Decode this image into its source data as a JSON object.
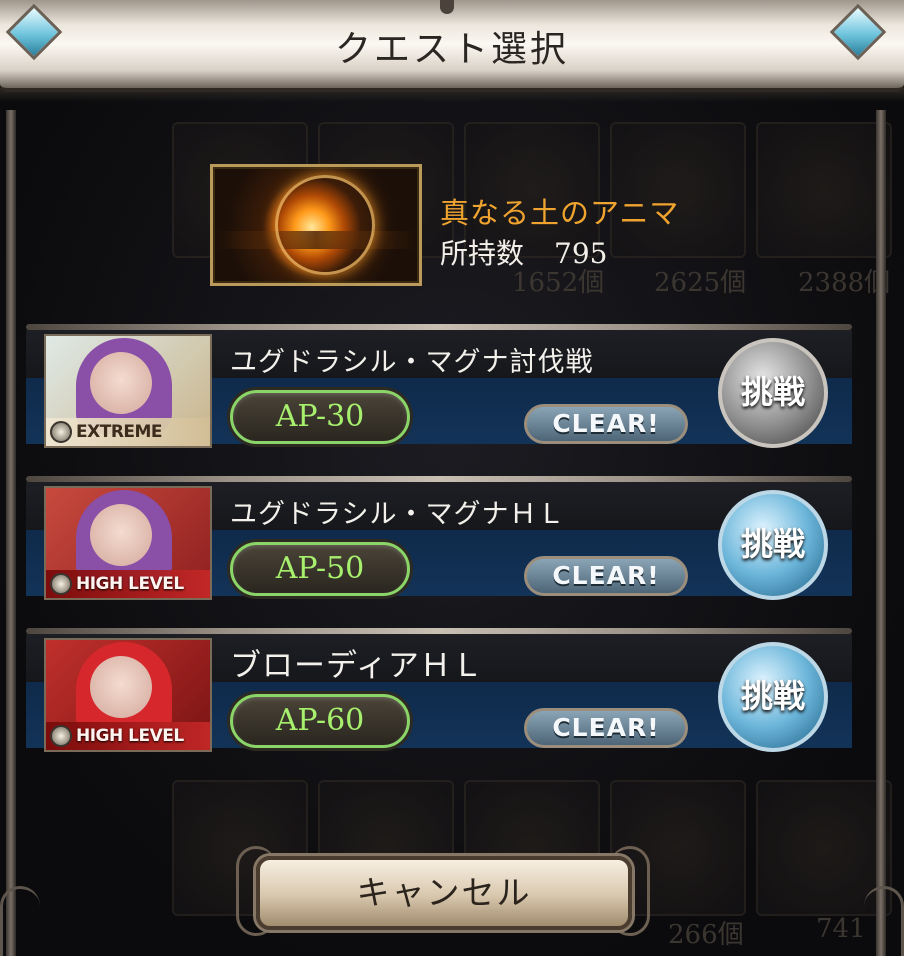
{
  "header": {
    "title": "クエスト選択"
  },
  "item": {
    "name": "真なる土のアニマ",
    "owned_label": "所持数",
    "owned_count": "795"
  },
  "background_counts": [
    "1652個",
    "2625個",
    "2388個",
    "266個",
    "741"
  ],
  "quests": [
    {
      "name": "ユグドラシル・マグナ討伐戦",
      "difficulty": "EXTREME",
      "ap": "AP-30",
      "clear": "CLEAR!",
      "button": "挑戦",
      "button_style": "silver",
      "banner_colors": {
        "bg": "#c9c3a8",
        "hair": "#8a4fa6"
      }
    },
    {
      "name": "ユグドラシル・マグナＨＬ",
      "difficulty": "HIGH LEVEL",
      "ap": "AP-50",
      "clear": "CLEAR!",
      "button": "挑戦",
      "button_style": "blue",
      "banner_colors": {
        "bg": "#a62b2b",
        "hair": "#8a4fa6"
      }
    },
    {
      "name": "ブローディアＨＬ",
      "difficulty": "HIGH LEVEL",
      "ap": "AP-60",
      "clear": "CLEAR!",
      "button": "挑戦",
      "button_style": "blue",
      "banner_colors": {
        "bg": "#9a1f1f",
        "hair": "#d6282c"
      }
    }
  ],
  "footer": {
    "cancel_label": "キャンセル"
  },
  "colors": {
    "item_name": "#f0a430",
    "ap_text": "#a7f06e",
    "ap_border": "#8ad468",
    "panel_blue": "#123358"
  },
  "icons": {
    "title_left": "diamond-gem-icon",
    "title_right": "diamond-gem-icon",
    "difficulty_badge": "star-badge-icon"
  }
}
